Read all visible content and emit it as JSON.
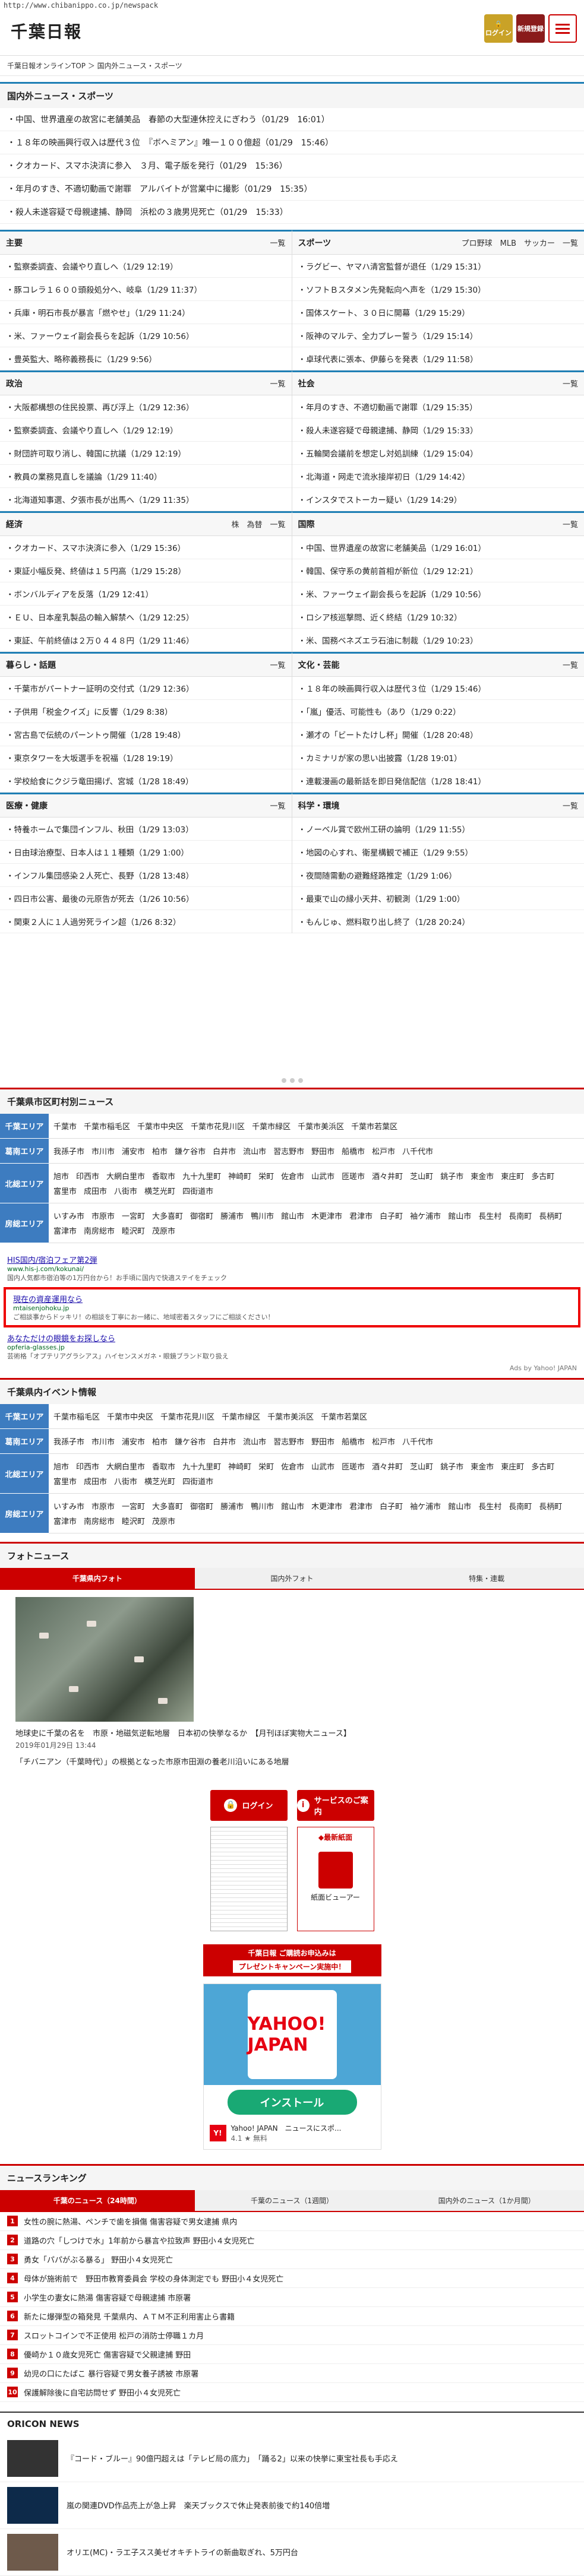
{
  "url": "http://www.chibanippo.co.jp/newspack",
  "header": {
    "logo": "千葉日報",
    "login": "ログイン",
    "register": "新規登録",
    "menu_icon": "hamburger-icon"
  },
  "breadcrumb": "千葉日報オンラインTOP ＞ 国内外ニュース・スポーツ",
  "domestic": {
    "title": "国内外ニュース・スポーツ",
    "items": [
      "・中国、世界遺産の故宮に老舗美品　春節の大型連休控えにぎわう（01/29　16:01）",
      "・１８年の映画興行収入は歴代３位　『ボヘミアン』唯一１００億超（01/29　15:46）",
      "・クオカード、スマホ決済に参入　３月、電子版を発行（01/29　15:36）",
      "・年月のすき、不適切動画で謝罪　アルバイトが営業中に撮影（01/29　15:35）",
      "・殺人未遂容疑で母親逮捕、静岡　浜松の３歳男児死亡（01/29　15:33）"
    ]
  },
  "categories": [
    {
      "title": "主要",
      "more": "一覧",
      "items": [
        "・監察委調査、会議やり直しへ（1/29 12:19）",
        "・豚コレラ１６００頭殺処分へ、岐阜（1/29 11:37）",
        "・兵庫・明石市長が暴言「燃やせ」（1/29 11:24）",
        "・米、ファーウェイ副会長らを起訴（1/29 10:56）",
        "・豊英監大、略称義務長に（1/29 9:56）"
      ]
    },
    {
      "title": "スポーツ",
      "more": "プロ野球　MLB　サッカー　一覧",
      "items": [
        "・ラグビー、ヤマハ清宮監督が退任（1/29 15:31）",
        "・ソフトＢスタメン先発転向へ声を（1/29 15:30）",
        "・国体スケート、３０日に開幕（1/29 15:29）",
        "・阪神のマルテ、全力プレー誓う（1/29 15:14）",
        "・卓球代表に張本、伊藤らを発表（1/29 11:58）"
      ]
    },
    {
      "title": "政治",
      "more": "一覧",
      "items": [
        "・大阪都構想の住民投票、再び浮上（1/29 12:36）",
        "・監察委調査、会議やり直しへ（1/29 12:19）",
        "・財団許可取り消し、韓国に抗議（1/29 12:19）",
        "・教員の業務見直しを議論（1/29 11:40）",
        "・北海道知事選、夕張市長が出馬へ（1/29 11:35）"
      ]
    },
    {
      "title": "社会",
      "more": "一覧",
      "items": [
        "・年月のすき、不適切動画で謝罪（1/29 15:35）",
        "・殺人未遂容疑で母親逮捕、静岡（1/29 15:33）",
        "・五輪関会議前を想定し対処訓練（1/29 15:04）",
        "・北海道・网走で流氷接岸初日（1/29 14:42）",
        "・インスタでストーカー疑い（1/29 14:29）"
      ]
    },
    {
      "title": "経済",
      "more": "株　為替　一覧",
      "items": [
        "・クオカード、スマホ決済に参入（1/29 15:36）",
        "・東証小幅反発、終値は１５円高（1/29 15:28）",
        "・ボンバルディアを反落（1/29 12:41）",
        "・ＥＵ、日本産乳製品の輸入解禁へ（1/29 12:25）",
        "・東証、午前終値は２万０４４８円（1/29 11:46）"
      ]
    },
    {
      "title": "国際",
      "more": "一覧",
      "items": [
        "・中国、世界遺産の故宮に老舗美品（1/29 16:01）",
        "・韓国、保守系の黄前首相が新位（1/29 12:21）",
        "・米、ファーウェイ副会長らを起訴（1/29 10:56）",
        "・ロシア核巡撃問、近く終結（1/29 10:32）",
        "・米、国務ベネズエラ石油に制裁（1/29 10:23）"
      ]
    },
    {
      "title": "暮らし・話題",
      "more": "一覧",
      "items": [
        "・千葉市がパートナー証明の交付式（1/29 12:36）",
        "・子供用「税金クイズ」に反響（1/29 8:38）",
        "・宮古島で伝統のパーントゥ開催（1/28 19:48）",
        "・東京タワーを大坂選手を祝福（1/28 19:19）",
        "・学校給食にクジラ竜田揚げ、宮城（1/28 18:49）"
      ]
    },
    {
      "title": "文化・芸能",
      "more": "一覧",
      "items": [
        "・１８年の映画興行収入は歴代３位（1/29 15:46）",
        "・「嵐」優活、可能性も（あり（1/29 0:22）",
        "・瀬才の「ビートたけし杯」開催（1/28 20:48）",
        "・カミナリが家の思い出披露（1/28 19:01）",
        "・連載漫画の最新話を即日発信配信（1/28 18:41）"
      ]
    },
    {
      "title": "医療・健康",
      "more": "一覧",
      "items": [
        "・特養ホームで集団インフル、秋田（1/29 13:03）",
        "・日由球治療型、日本人は１１種類（1/29 1:00）",
        "・インフル集団感染２人死亡、長野（1/28 13:48）",
        "・四日市公害、最後の元原告が死去（1/26 10:56）",
        "・関東２人に１人過労死ライン超（1/26 8:32）"
      ]
    },
    {
      "title": "科学・環境",
      "more": "一覧",
      "items": [
        "・ノーベル賞で欧州工研の論明（1/29 11:55）",
        "・地図の心すれ、衛星構観で補正（1/29 9:55）",
        "・夜間随需動の避難経路推定（1/29 1:06）",
        "・最東で山の縁小天井、初観測（1/29 1:00）",
        "・もんじゅ、燃料取り出し終了（1/28 20:24）"
      ]
    }
  ],
  "areas": {
    "title": "千葉県市区町村別ニュース",
    "rows": [
      {
        "label": "千葉エリア",
        "cities": [
          "千葉市",
          "千葉市稲毛区",
          "千葉市中央区",
          "千葉市花見川区",
          "千葉市緑区",
          "千葉市美浜区",
          "千葉市若葉区"
        ]
      },
      {
        "label": "葛南エリア",
        "cities": [
          "我孫子市",
          "市川市",
          "浦安市",
          "柏市",
          "鎌ケ谷市",
          "白井市",
          "流山市",
          "習志野市",
          "野田市",
          "船橋市",
          "松戸市",
          "八千代市"
        ]
      },
      {
        "label": "北総エリア",
        "cities": [
          "旭市",
          "印西市",
          "大網白里市",
          "香取市",
          "九十九里町",
          "神崎町",
          "栄町",
          "佐倉市",
          "山武市",
          "匝瑳市",
          "酒々井町",
          "芝山町",
          "銚子市",
          "東金市",
          "東庄町",
          "多古町",
          "富里市",
          "成田市",
          "八街市",
          "横芝光町",
          "四街道市"
        ]
      },
      {
        "label": "房総エリア",
        "cities": [
          "いすみ市",
          "市原市",
          "一宮町",
          "大多喜町",
          "御宿町",
          "勝浦市",
          "鴨川市",
          "館山市",
          "木更津市",
          "君津市",
          "白子町",
          "袖ケ浦市",
          "館山市",
          "長生村",
          "長南町",
          "長柄町",
          "富津市",
          "南房総市",
          "睦沢町",
          "茂原市"
        ]
      }
    ]
  },
  "sponsored": [
    {
      "title": "HIS国内/宿泊フェア第2弾",
      "url": "www.his-j.com/kokunai/",
      "desc": "国内人気都市宿泊等の1万円台から！お手頃に国内で快適ステイをチェック"
    },
    {
      "title": "現在の資産運用なら",
      "url": "mtaisenjohoku.jp",
      "desc": "ご相談事からドッキリ！の相談を丁寧にお一緒に、地域密着スタッフにご相談ください！"
    },
    {
      "title": "あなただけの眼鏡をお探しなら",
      "url": "opferia-glasses.jp",
      "desc": "芸術格「オプテリアグラシアス」ハイセンスメガネ・眼鏡ブランド取り扱え"
    }
  ],
  "ads_by": "Ads by Yahoo! JAPAN",
  "events": {
    "title": "千葉県内イベント情報",
    "rows": [
      {
        "label": "千葉エリア",
        "cities": [
          "千葉市稲毛区",
          "千葉市中央区",
          "千葉市花見川区",
          "千葉市緑区",
          "千葉市美浜区",
          "千葉市若葉区"
        ]
      },
      {
        "label": "葛南エリア",
        "cities": [
          "我孫子市",
          "市川市",
          "浦安市",
          "柏市",
          "鎌ケ谷市",
          "白井市",
          "流山市",
          "習志野市",
          "野田市",
          "船橋市",
          "松戸市",
          "八千代市"
        ]
      },
      {
        "label": "北総エリア",
        "cities": [
          "旭市",
          "印西市",
          "大網白里市",
          "香取市",
          "九十九里町",
          "神崎町",
          "栄町",
          "佐倉市",
          "山武市",
          "匝瑳市",
          "酒々井町",
          "芝山町",
          "銚子市",
          "東金市",
          "東庄町",
          "多古町",
          "富里市",
          "成田市",
          "八街市",
          "横芝光町",
          "四街道市"
        ]
      },
      {
        "label": "房総エリア",
        "cities": [
          "いすみ市",
          "市原市",
          "一宮町",
          "大多喜町",
          "御宿町",
          "勝浦市",
          "鴨川市",
          "館山市",
          "木更津市",
          "君津市",
          "白子町",
          "袖ケ浦市",
          "館山市",
          "長生村",
          "長南町",
          "長柄町",
          "富津市",
          "南房総市",
          "睦沢町",
          "茂原市"
        ]
      }
    ]
  },
  "photo_news": {
    "title": "フォトニュース",
    "tabs": [
      "千葉県内フォト",
      "国内外フォト",
      "特集・連載"
    ],
    "caption": "地球史に千葉の名を　市原・地磁気逆転地層　日本初の快挙なるか　【月刊ほぼ実物大ニュース】",
    "date": "2019年01月29日 13:44",
    "sub": "「チバニアン（千葉時代）」の根拠となった市原市田淵の養老川沿いにある地層"
  },
  "side": {
    "login": "ログイン",
    "service": "サービスのご案内",
    "newest": "◆最新紙面",
    "viewer": "紙面ビューアー",
    "campaign_top": "千葉日報 ご購読お申込みは",
    "campaign_bottom": "プレゼントキャンペーン実施中！",
    "yahoo_logo": "YAHOO! JAPAN",
    "install": "インストール",
    "yahoo_app": "Yahoo! JAPAN　ニュースにスポ...",
    "yahoo_rating": "4.1 ★ 無料"
  },
  "ranking": {
    "title": "ニュースランキング",
    "tabs": [
      "千葉のニュース（24時間）",
      "千葉のニュース（1週間）",
      "国内外のニュース（1か月間）"
    ],
    "items": [
      "女性の腕に熱湯、ペンチで歯を損傷 傷害容疑で男女逮捕 県内",
      "道路の穴「しつけで水」1年前から暴言や拉致声 野田小４女児死亡",
      "勇女「パパがぶる暴る」 野田小４女児死亡",
      "母体が施術前で　野田市教育委員会 学校の身体測定でも 野田小４女児死亡",
      "小学生の妻女に熱湯 傷害容疑で母親逮捕 市原署",
      "新たに爆弾型の箱発見 千葉県内、ＡＴＭ不正利用害止ら書籍",
      "スロットコインで不正使用 松戸の消防士停職１カ月",
      "優崎か１０歳女児死亡 傷害容疑で父親逮捕 野田",
      "幼児の口にたばこ 暴行容疑で男女養子誘被 市原署",
      "保護解除後に自宅訪問せず 野田小４女児死亡"
    ]
  },
  "oricon": {
    "title": "ORICON NEWS",
    "items": [
      "『コード・ブルー』90億円超えは「テレビ局の底力」　「踊る2」以来の快挙に東宝社長も手応え",
      "嵐の関連DVD作品売上が急上昇　楽天ブックスで休止発表前後で約140倍増",
      "オリエ(MC)・ラエ子スス美ゼオキチトライの新曲取ぎれ、5万円台"
    ]
  }
}
